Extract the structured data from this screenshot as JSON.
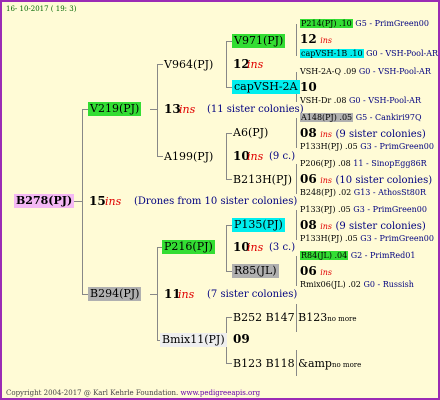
{
  "date_stamp": "16- 10-2017 ( 19: 3)",
  "root": {
    "id": "B278(PJ)",
    "gen": "15",
    "ins": "ins",
    "note": "(Drones from 10 sister colonies)"
  },
  "s": {
    "id": "V219(PJ)",
    "gen": "13",
    "ins": "ins",
    "note": "(11 sister colonies)"
  },
  "d": {
    "id": "B294(PJ)",
    "gen": "11",
    "ins": "ins",
    "note": "(7 sister colonies)"
  },
  "ss": {
    "id": "V964(PJ)",
    "gen": "12",
    "ins": "ins"
  },
  "sd": {
    "id": "A199(PJ)",
    "gen": "10",
    "ins": "ins",
    "note": "(9 c.)"
  },
  "ds": {
    "id": "P216(PJ)",
    "gen": "10",
    "ins": "ins",
    "note": "(3 c.)"
  },
  "dd": {
    "id": "Bmix11(PJ)",
    "gen": "09"
  },
  "sss": {
    "id": "V971(PJ)"
  },
  "ssd": {
    "id": "capVSH-2A",
    "gen": "10"
  },
  "sds": {
    "id": "A6(PJ)"
  },
  "sdd": {
    "id": "B213H(PJ)"
  },
  "dss": {
    "id": "P135(PJ)"
  },
  "dsd": {
    "id": "R85(JL)"
  },
  "dds": {
    "id": "B252 B147 B123",
    "tag": "no more"
  },
  "ddd": {
    "id": "B123 B118 &amp",
    "tag": "no more"
  },
  "l5": [
    {
      "a": "P214(PJ) .10",
      "b": "G5 - PrimGreen00"
    },
    {
      "gen": "12",
      "ins": "ins"
    },
    {
      "a": "capVSH-1B .10",
      "b": "G0 - VSH-Pool-AR"
    },
    {
      "a": "VSH-2A-Q .09",
      "b": "G0 - VSH-Pool-AR"
    },
    {
      "gen": "10"
    },
    {
      "a": "VSH-Dr .08",
      "b": "G0 - VSH-Pool-AR"
    },
    {
      "a": "A148(PJ) .05",
      "b": "G5 - Cankiri97Q"
    },
    {
      "gen": "08",
      "ins": "ins",
      "note": "(9 sister colonies)"
    },
    {
      "a": "P133H(PJ) .05",
      "b": "G3 - PrimGreen00"
    },
    {
      "a": "P206(PJ) .08",
      "b": "11 - SinopEgg86R"
    },
    {
      "gen": "06",
      "ins": "ins",
      "note": "(10 sister colonies)"
    },
    {
      "a": "B248(PJ) .02",
      "b": "G13 - AthosSt80R"
    },
    {
      "a": "P133(PJ) .05",
      "b": "G3 - PrimGreen00"
    },
    {
      "gen": "08",
      "ins": "ins",
      "note": "(9 sister colonies)"
    },
    {
      "a": "P133H(PJ) .05",
      "b": "G3 - PrimGreen00"
    },
    {
      "a": "R84(JL) .04",
      "b": "G2 - PrimRed01"
    },
    {
      "gen": "06",
      "ins": "ins"
    },
    {
      "a": "Rmix06(JL) .02",
      "b": "G0 - Russish"
    }
  ],
  "footer": {
    "copy": "Copyright 2004-2017 @ Karl Kehrle Foundation.",
    "url": "www.pedigreeapis.org"
  },
  "colors": {
    "green": "#33dd33",
    "cyan": "#00eeee",
    "grey": "#b0b0b0",
    "pink": "#f4b8f4",
    "ins": "#e00000",
    "border": "#9b2bb5",
    "bg": "#fffbd6"
  }
}
